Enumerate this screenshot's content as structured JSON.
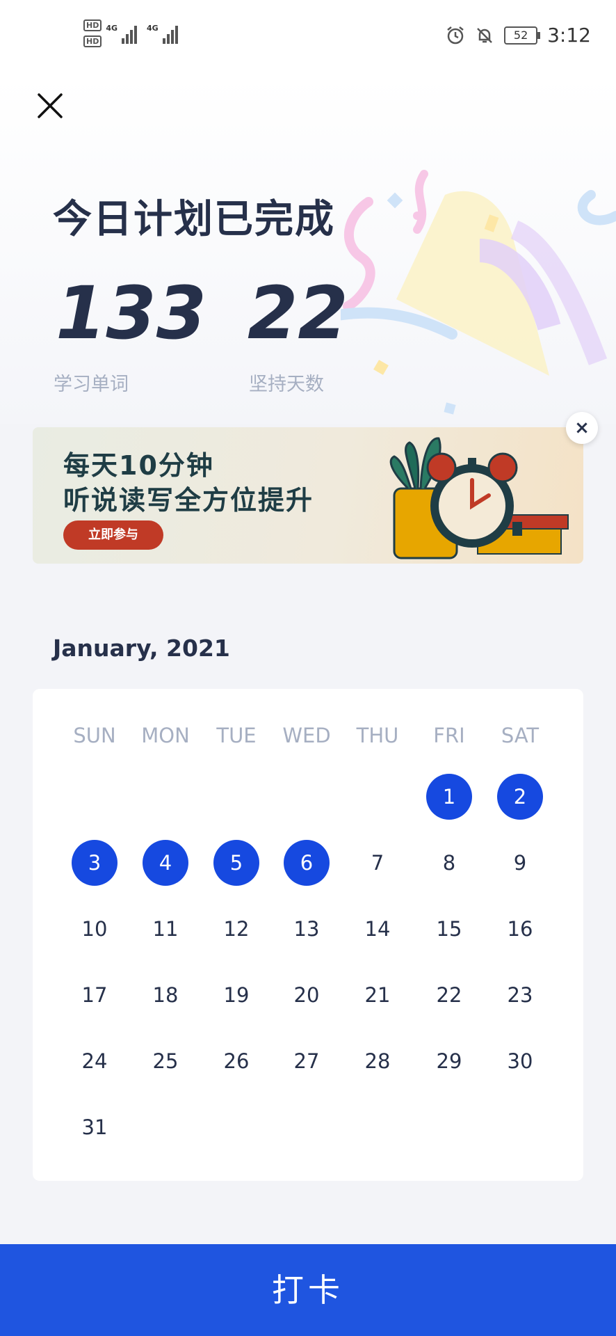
{
  "status_bar": {
    "hd1": "HD",
    "hd2": "HD",
    "net1": "4G",
    "net2": "4G",
    "battery": "52",
    "time": "3:12"
  },
  "header": {
    "close_icon": "close-icon"
  },
  "summary": {
    "title": "今日计划已完成",
    "words_count": "133",
    "words_label": "学习单词",
    "days_count": "22",
    "days_label": "坚持天数"
  },
  "banner": {
    "line1": "每天10分钟",
    "line2": "听说读写全方位提升",
    "button": "立即参与",
    "close": "×"
  },
  "calendar": {
    "month_title": "January, 2021",
    "weekdays": [
      "SUN",
      "MON",
      "TUE",
      "WED",
      "THU",
      "FRI",
      "SAT"
    ],
    "first_weekday_index": 5,
    "days_in_month": 31,
    "checked_days": [
      1,
      2,
      3,
      4,
      5,
      6
    ]
  },
  "footer": {
    "checkin_label": "打卡"
  },
  "colors": {
    "accent": "#1649e0",
    "button_bg": "#1f55e0",
    "text_dark": "#26304a",
    "text_muted": "#a6afc2"
  }
}
